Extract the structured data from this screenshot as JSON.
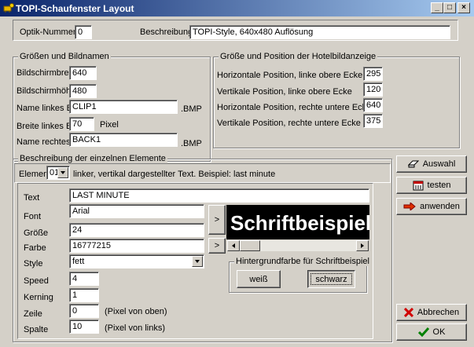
{
  "window": {
    "title": "TOPI-Schaufenster Layout",
    "minimize": "_",
    "maximize": "□",
    "close": "×"
  },
  "top": {
    "optik_label": "Optik-Nummer",
    "optik_value": "0",
    "beschreibung_label": "Beschreibung",
    "beschreibung_value": "TOPI-Style, 640x480 Auflösung"
  },
  "sizes": {
    "title": "Größen und Bildnamen",
    "breite_label": "Bildschirmbreite",
    "breite_value": "640",
    "hoehe_label": "Bildschirmhöhe",
    "hoehe_value": "480",
    "name_links_label": "Name linkes Bild",
    "name_links_value": "CLIP1",
    "ext1": ".BMP",
    "breite_links_label": "Breite linkes Bild",
    "breite_links_value": "70",
    "pixel": "Pixel",
    "name_rechts_label": "Name rechtes Bild",
    "name_rechts_value": "BACK1",
    "ext2": ".BMP"
  },
  "hotel": {
    "title": "Größe und Position der Hotelbildanzeige",
    "h1_label": "Horizontale Position, linke obere Ecke",
    "h1_value": "295",
    "v1_label": "Vertikale Position, linke obere Ecke",
    "v1_value": "120",
    "h2_label": "Horizontale Position, rechte untere Ecke",
    "h2_value": "640",
    "v2_label": "Vertikale Position, rechte untere Ecke",
    "v2_value": "375"
  },
  "elements": {
    "title": "Beschreibung der einzelnen Elemente",
    "element_label": "Element",
    "element_value": "01",
    "element_desc": "linker, vertikal dargestellter Text. Beispiel: last minute",
    "text_label": "Text",
    "text_value": "LAST MINUTE",
    "font_label": "Font",
    "font_value": "Arial",
    "groesse_label": "Größe",
    "groesse_value": "24",
    "farbe_label": "Farbe",
    "farbe_value": "16777215",
    "style_label": "Style",
    "style_value": "fett",
    "speed_label": "Speed",
    "speed_value": "4",
    "kerning_label": "Kerning",
    "kerning_value": "1",
    "zeile_label": "Zeile",
    "zeile_value": "0",
    "zeile_hint": "(Pixel von oben)",
    "spalte_label": "Spalte",
    "spalte_value": "10",
    "spalte_hint": "(Pixel von links)",
    "arrow1": ">",
    "arrow2": ">",
    "preview_text": "Schriftbeispiel",
    "bg_title": "Hintergrundfarbe für Schriftbeispiel",
    "weiss": "weiß",
    "schwarz": "schwarz"
  },
  "actions": {
    "auswahl": "Auswahl",
    "testen": "testen",
    "anwenden": "anwenden",
    "abbrechen": "Abbrechen",
    "ok": "OK"
  },
  "colors": {
    "titlebar_start": "#0a246a",
    "titlebar_end": "#a6caf0",
    "face": "#d4d0c8"
  }
}
